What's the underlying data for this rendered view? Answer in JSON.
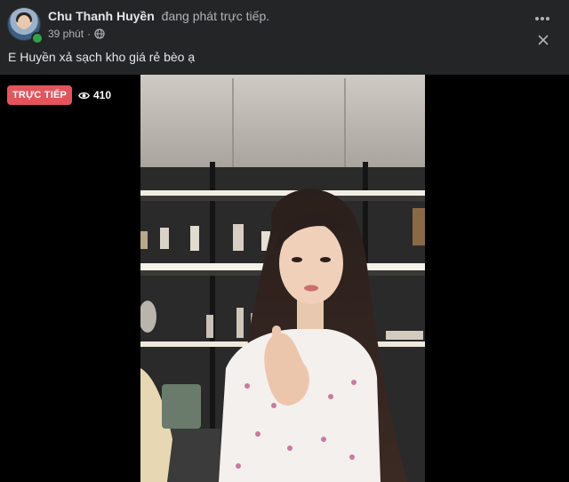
{
  "post": {
    "author": "Chu Thanh Huyền",
    "status": "đang phát trực tiếp.",
    "time": "39 phút",
    "separator": "·",
    "text": "E Huyền xả sạch kho giá rẻ bèo ạ",
    "more_icon": "more-horizontal-icon",
    "close_icon": "close-icon"
  },
  "video": {
    "live_label": "TRỰC TIẾP",
    "viewer_count": "410",
    "viewer_icon": "eye-icon"
  },
  "colors": {
    "background": "#242526",
    "text_primary": "#e4e6eb",
    "text_secondary": "#b0b3b8",
    "live_badge": "#e4545c",
    "online": "#31a24c"
  }
}
